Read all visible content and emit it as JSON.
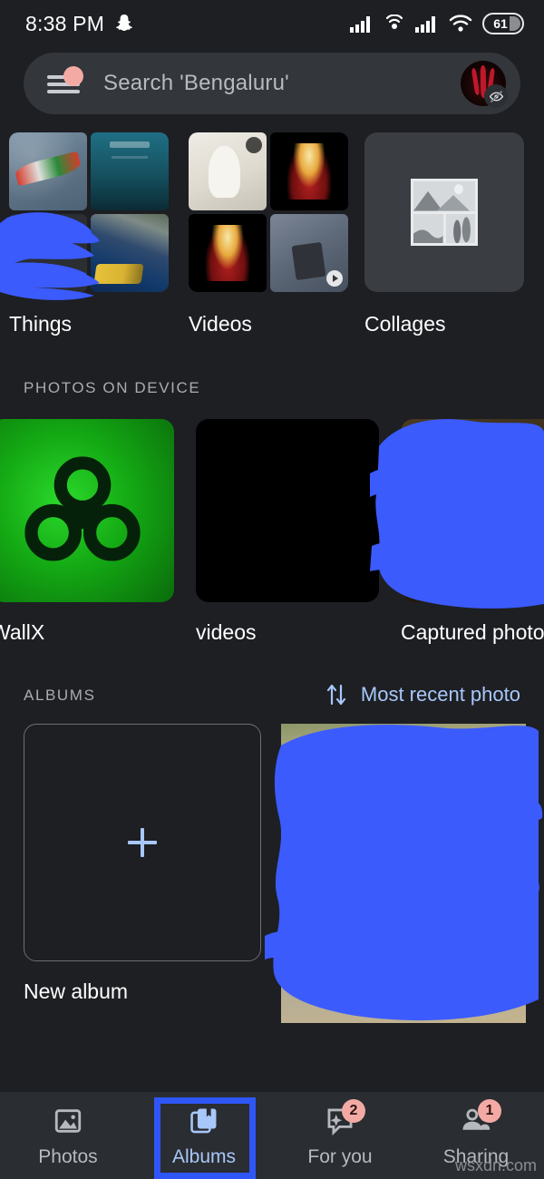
{
  "statusbar": {
    "time": "8:38 PM",
    "battery_level": "61",
    "icons": [
      "snapchat-icon",
      "signal-icon",
      "hotspot-icon",
      "signal-icon",
      "wifi-icon",
      "battery-icon"
    ]
  },
  "search": {
    "placeholder": "Search 'Bengaluru'",
    "menu_icon": "hamburger-menu-icon",
    "avatar_badge_icon": "eye-off-icon"
  },
  "categories": [
    {
      "label": "Things"
    },
    {
      "label": "Videos"
    },
    {
      "label": "Collages"
    }
  ],
  "device_section": {
    "header": "PHOTOS ON DEVICE",
    "items": [
      {
        "label": "WallX"
      },
      {
        "label": "videos"
      },
      {
        "label": "Captured photo"
      }
    ]
  },
  "albums_section": {
    "header": "ALBUMS",
    "sort_label": "Most recent photo",
    "sort_icon": "sort-arrows-icon",
    "new_album_label": "New album",
    "new_album_icon": "plus-icon"
  },
  "bottom_nav": {
    "items": [
      {
        "label": "Photos",
        "icon": "photos-icon",
        "badge": "",
        "active": false
      },
      {
        "label": "Albums",
        "icon": "albums-icon",
        "badge": "",
        "active": true
      },
      {
        "label": "For you",
        "icon": "for-you-icon",
        "badge": "2",
        "active": false
      },
      {
        "label": "Sharing",
        "icon": "sharing-icon",
        "badge": "1",
        "active": false
      }
    ]
  },
  "watermark": {
    "text": "wsxdn.com"
  },
  "colors": {
    "background": "#1d1f23",
    "searchbar": "#33363a",
    "navbar": "#2a2d31",
    "accent_blue": "#a8c7fa",
    "highlight": "#2f56f7",
    "badge_pink": "#f4aaa4",
    "scribble": "#3b5bfd"
  }
}
